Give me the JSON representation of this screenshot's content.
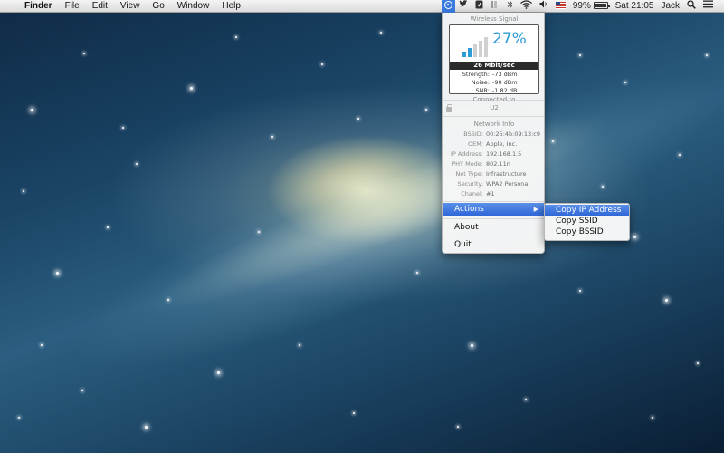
{
  "menubar": {
    "apple_icon": "",
    "app_name": "Finder",
    "menus": [
      "File",
      "Edit",
      "View",
      "Go",
      "Window",
      "Help"
    ],
    "status": {
      "battery_percent": "99%",
      "clock": "Sat 21:05",
      "user": "Jack"
    }
  },
  "wifi_menu": {
    "signal_title": "Wireless Signal",
    "signal_percent": "27%",
    "signal_strength_fraction": 0.27,
    "speed": "26 Mbit/sec",
    "stats": [
      {
        "label": "Strength:",
        "value": "-73 dBm"
      },
      {
        "label": "Noise:",
        "value": "-90 dBm"
      },
      {
        "label": "SNR:",
        "value": "-1.82 dB"
      }
    ],
    "connected_title": "Connected to",
    "ssid": "U2",
    "netinfo_title": "Network Info",
    "netinfo": [
      {
        "label": "BSSID:",
        "value": "00:25:4b:09:13:c9"
      },
      {
        "label": "OEM:",
        "value": "Apple, Inc."
      },
      {
        "label": "IP Address:",
        "value": "192.168.1.5"
      },
      {
        "label": "PHY Mode:",
        "value": "802.11n"
      },
      {
        "label": "Net Type:",
        "value": "Infrastructure"
      },
      {
        "label": "Security:",
        "value": "WPA2 Personal"
      },
      {
        "label": "Chanel:",
        "value": "#1"
      }
    ],
    "actions_label": "Actions",
    "about_label": "About",
    "quit_label": "Quit"
  },
  "actions_submenu": {
    "items": [
      "Copy IP Address",
      "Copy SSID",
      "Copy BSSID"
    ]
  },
  "colors": {
    "accent": "#2f9bd7",
    "highlight": "#3b72dc",
    "menubar": "#e8e8e8"
  },
  "icons": [
    "apple-icon",
    "wifi-signal-status-icon",
    "twitter-icon",
    "evernote-icon",
    "bluetooth-icon",
    "wifi-icon",
    "volume-icon",
    "flag-icon",
    "battery-icon",
    "spotlight-icon",
    "notification-list-icon"
  ]
}
